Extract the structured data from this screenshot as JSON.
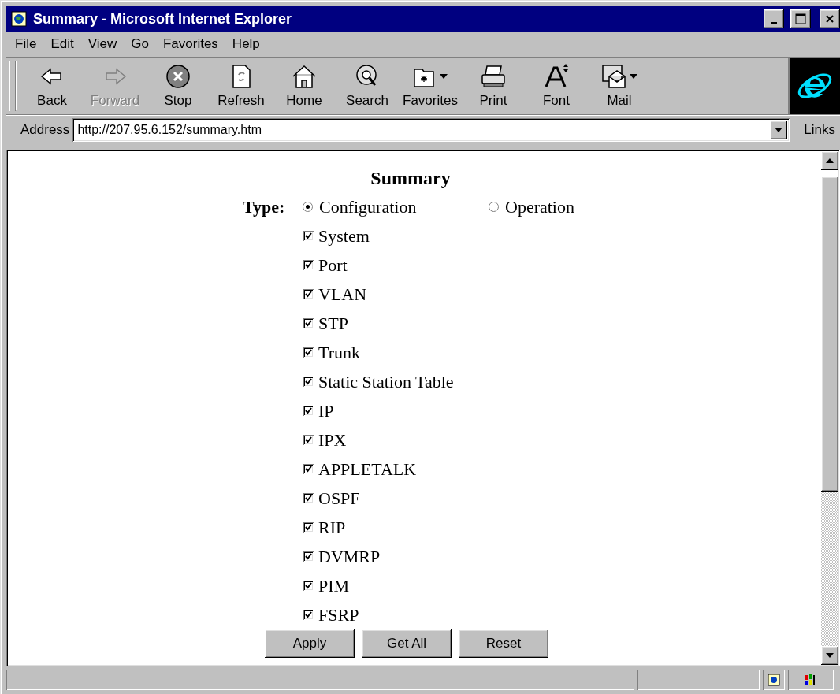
{
  "window": {
    "title": "Summary - Microsoft Internet Explorer"
  },
  "menu": [
    "File",
    "Edit",
    "View",
    "Go",
    "Favorites",
    "Help"
  ],
  "toolbar": [
    {
      "kind": "back",
      "label": "Back",
      "disabled": false,
      "dropdown": false
    },
    {
      "kind": "forward",
      "label": "Forward",
      "disabled": true,
      "dropdown": false
    },
    {
      "kind": "stop",
      "label": "Stop",
      "disabled": false,
      "dropdown": false
    },
    {
      "kind": "refresh",
      "label": "Refresh",
      "disabled": false,
      "dropdown": false
    },
    {
      "kind": "home",
      "label": "Home",
      "disabled": false,
      "dropdown": false
    },
    {
      "kind": "search",
      "label": "Search",
      "disabled": false,
      "dropdown": false
    },
    {
      "kind": "favorites",
      "label": "Favorites",
      "disabled": false,
      "dropdown": true
    },
    {
      "kind": "print",
      "label": "Print",
      "disabled": false,
      "dropdown": false
    },
    {
      "kind": "font",
      "label": "Font",
      "disabled": false,
      "dropdown": false
    },
    {
      "kind": "mail",
      "label": "Mail",
      "disabled": false,
      "dropdown": true
    }
  ],
  "address_bar": {
    "label": "Address",
    "value": "http://207.95.6.152/summary.htm",
    "links": "Links"
  },
  "page": {
    "title": "Summary",
    "type_label": "Type:",
    "type_options": [
      {
        "label": "Configuration",
        "selected": true
      },
      {
        "label": "Operation",
        "selected": false
      }
    ],
    "sections": [
      {
        "label": "System",
        "checked": true
      },
      {
        "label": "Port",
        "checked": true
      },
      {
        "label": "VLAN",
        "checked": true
      },
      {
        "label": "STP",
        "checked": true
      },
      {
        "label": "Trunk",
        "checked": true
      },
      {
        "label": "Static Station Table",
        "checked": true
      },
      {
        "label": "IP",
        "checked": true
      },
      {
        "label": "IPX",
        "checked": true
      },
      {
        "label": "APPLETALK",
        "checked": true
      },
      {
        "label": "OSPF",
        "checked": true
      },
      {
        "label": "RIP",
        "checked": true
      },
      {
        "label": "DVMRP",
        "checked": true
      },
      {
        "label": "PIM",
        "checked": true
      },
      {
        "label": "FSRP",
        "checked": true
      }
    ],
    "buttons": [
      "Apply",
      "Get All",
      "Reset"
    ]
  }
}
